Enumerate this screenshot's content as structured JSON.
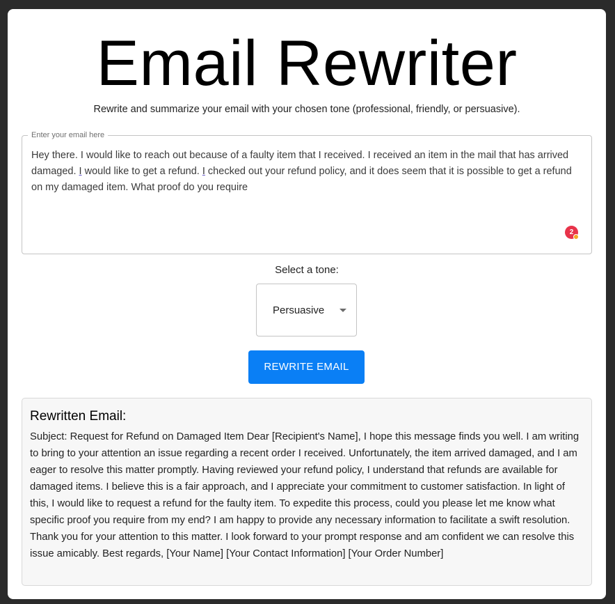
{
  "app": {
    "title": "Email Rewriter",
    "subtitle": "Rewrite and summarize your email with your chosen tone (professional, friendly, or persuasive)."
  },
  "input": {
    "label": "Enter your email here",
    "value_parts": [
      "Hey there. I would like to reach out because of a faulty item that I received. I received an item in the mail that has arrived damaged. ",
      "I",
      " would like to get a refund. ",
      "I",
      " checked out your refund policy, and it does seem that it is possible to get a refund on my damaged item. What proof do you require"
    ],
    "grammar_badge_count": "2"
  },
  "tone": {
    "label": "Select a tone:",
    "selected": "Persuasive"
  },
  "button": {
    "label": "REWRITE EMAIL"
  },
  "output": {
    "title": "Rewritten Email:",
    "text": "Subject: Request for Refund on Damaged Item Dear [Recipient's Name], I hope this message finds you well. I am writing to bring to your attention an issue regarding a recent order I received. Unfortunately, the item arrived damaged, and I am eager to resolve this matter promptly. Having reviewed your refund policy, I understand that refunds are available for damaged items. I believe this is a fair approach, and I appreciate your commitment to customer satisfaction. In light of this, I would like to request a refund for the faulty item. To expedite this process, could you please let me know what specific proof you require from my end? I am happy to provide any necessary information to facilitate a swift resolution. Thank you for your attention to this matter. I look forward to your prompt response and am confident we can resolve this issue amicably. Best regards, [Your Name] [Your Contact Information] [Your Order Number]"
  },
  "colors": {
    "button_bg": "#0a7ff5",
    "page_bg": "#2b2b2b",
    "badge": "#e8334a"
  }
}
